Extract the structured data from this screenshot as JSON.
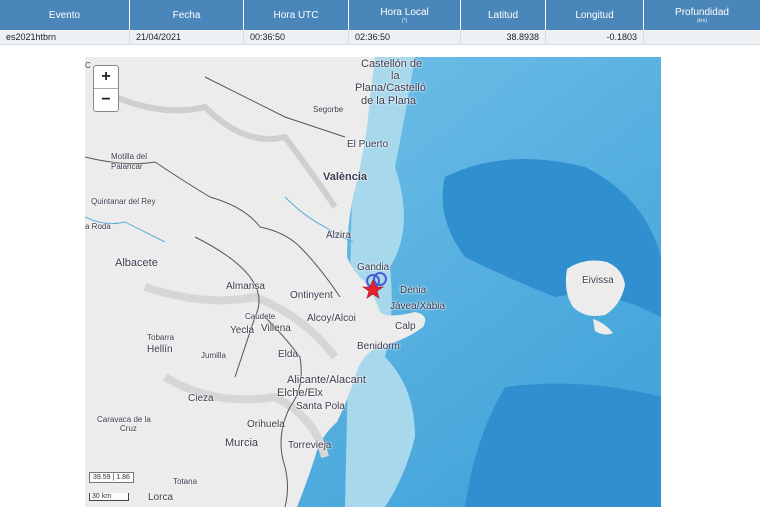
{
  "table": {
    "headers": [
      {
        "label": "Evento",
        "sub": ""
      },
      {
        "label": "Fecha",
        "sub": ""
      },
      {
        "label": "Hora UTC",
        "sub": ""
      },
      {
        "label": "Hora Local",
        "sub": "(*)"
      },
      {
        "label": "Latitud",
        "sub": ""
      },
      {
        "label": "Longitud",
        "sub": ""
      },
      {
        "label": "Profundidad",
        "sub": "(km)"
      }
    ],
    "row": {
      "evento": "es2021htbrn",
      "fecha": "21/04/2021",
      "hora_utc": "00:36:50",
      "hora_local": "02:36:50",
      "latitud": "38.8938",
      "longitud": "-0.1803",
      "profundidad": ""
    }
  },
  "map": {
    "zoom_in": "+",
    "zoom_out": "−",
    "coord_readout": "39.59 | 1.86",
    "scale_label": "30 km",
    "colors": {
      "land": "#ececec",
      "sea_shallow": "#a8d8ec",
      "sea_mid": "#5fb6e0",
      "sea_deep": "#3a9fd8",
      "border": "#555555",
      "marker": "#e8222b",
      "circle": "#4b5bd6"
    },
    "labels": {
      "castellon1": "Castellón de",
      "castellon2": "la",
      "castellon3": "Plana/Castelló",
      "castellon4": "de la Plana",
      "segorbe": "Segorbe",
      "elpuerto": "El Puerto",
      "valencia": "València",
      "motilla1": "Motilla del",
      "motilla2": "Palancar",
      "quintanar": "Quintanar del Rey",
      "roda": "a Roda",
      "alzira": "Alzira",
      "albacete": "Albacete",
      "gandia": "Gandia",
      "almansa": "Almansa",
      "ontinyent": "Ontinyent",
      "denia": "Dénia",
      "javea": "Jávea/Xàbia",
      "caudete": "Caudete",
      "alcoy": "Alcoy/Alcoi",
      "calp": "Calp",
      "tobarra": "Tobarra",
      "yecla": "Yecla",
      "villena": "Villena",
      "hellin": "Hellín",
      "benidorm": "Benidorm",
      "jumilla": "Jumilla",
      "elda": "Elda",
      "alicante": "Alicante/Alacant",
      "elche": "Elche/Elx",
      "santapola": "Santa Pola",
      "cieza": "Cieza",
      "caravaca1": "Caravaca de la",
      "caravaca2": "Cruz",
      "orihuela": "Orihuela",
      "murcia": "Murcia",
      "torrevieja": "Torrevieja",
      "totana": "Totana",
      "lorca": "Lorca",
      "eivissa": "Eivissa",
      "c_edge": "C"
    }
  }
}
